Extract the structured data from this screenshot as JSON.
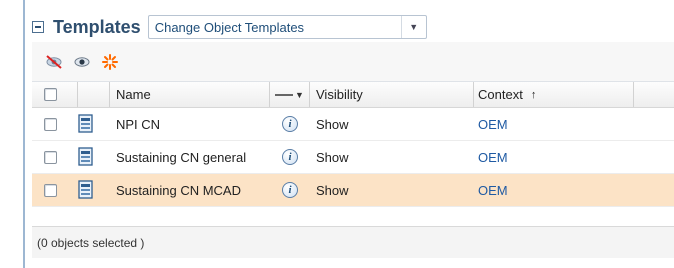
{
  "header": {
    "title": "Templates",
    "dropdown_value": "Change Object Templates"
  },
  "toolbar": {
    "icons": [
      "hide-icon",
      "show-icon",
      "reset-icon"
    ]
  },
  "table": {
    "columns": {
      "name": "Name",
      "visibility": "Visibility",
      "context": "Context"
    },
    "sort": {
      "column": "Context",
      "direction": "ascending"
    },
    "rows": [
      {
        "name": "NPI CN",
        "visibility": "Show",
        "context": "OEM",
        "selected": false
      },
      {
        "name": "Sustaining CN general",
        "visibility": "Show",
        "context": "OEM",
        "selected": false
      },
      {
        "name": "Sustaining CN MCAD",
        "visibility": "Show",
        "context": "OEM",
        "selected": true
      }
    ]
  },
  "footer": {
    "status": "(0 objects selected )"
  },
  "colors": {
    "title": "#2f4f6f",
    "link": "#1f5aa3",
    "selected_row": "#fce3c6",
    "reset_icon": "#ff6a00"
  }
}
